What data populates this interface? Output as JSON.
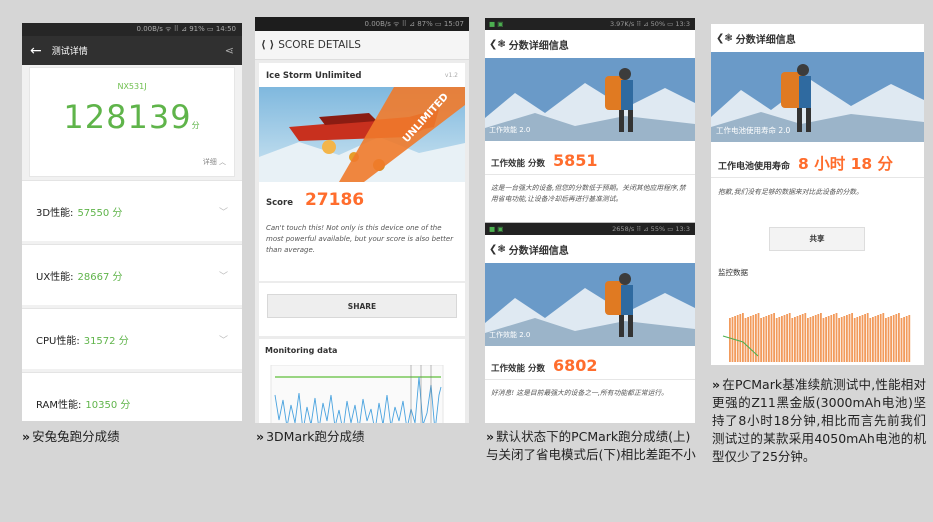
{
  "panel1": {
    "status": "0.00B/s ᯤ ⠿ ⊿ 91% ▭ 14:50",
    "title": "测试详情",
    "back": "←",
    "share": "⋖",
    "model": "NX531J",
    "score": "128139",
    "score_unit": "分",
    "detail": "详细 ︿",
    "rows": [
      {
        "label": "3D性能:",
        "value": "57550 分"
      },
      {
        "label": "UX性能:",
        "value": "28667 分"
      },
      {
        "label": "CPU性能:",
        "value": "31572 分"
      },
      {
        "label": "RAM性能:",
        "value": "10350 分"
      }
    ],
    "caption": "安兔兔跑分成绩"
  },
  "panel2": {
    "status": "0.00B/s ᯤ ⠿ ⊿ 87% ▭ 15:07",
    "header": "SCORE DETAILS",
    "test": "Ice Storm Unlimited",
    "test_info": "v1.2",
    "banner": "UNLIMITED",
    "score_label": "Score",
    "score": "27186",
    "desc": "Can't touch this! Not only is this device one of the most powerful available, but your score is also better than average.",
    "share": "SHARE",
    "monitoring": "Monitoring data",
    "caption": "3DMark跑分成绩"
  },
  "panel3": {
    "top": {
      "status": "3.97K/s ⠿ ⊿ 50% ▭ 13:3",
      "header": "分数详细信息",
      "overlay": "工作效能 2.0",
      "score_label": "工作效能 分数",
      "score": "5851",
      "desc": "这是一台强大的设备,但您的分数低于预期。关闭其他应用程序,禁用省电功能,让设备冷却后再进行基准测试。"
    },
    "bottom": {
      "status": "2658/s ⠿ ⊿ 55% ▭ 13:3",
      "header": "分数详细信息",
      "overlay": "工作效能 2.0",
      "score_label": "工作效能 分数",
      "score": "6802",
      "desc": "好消息! 这是目前最强大的设备之一,所有功能都正常运行。"
    },
    "caption": "默认状态下的PCMark跑分成绩(上)与关闭了省电模式后(下)相比差距不小"
  },
  "panel4": {
    "header": "分数详细信息",
    "overlay": "工作电池使用寿命 2.0",
    "score_label": "工作电池使用寿命",
    "score": "8 小时 18 分",
    "desc": "抱歉,我们没有足够的数据来对比此设备的分数。",
    "share": "共享",
    "monitoring": "监控数据",
    "caption": "在PCMark基准续航测试中,性能相对更强的Z11黑金版(3000mAh电池)坚持了8小时18分钟,相比而言先前我们测试过的某款采用4050mAh电池的机型仅少了25分钟。"
  },
  "caption_marker": "»",
  "colors": {
    "green": "#5fb44a",
    "orange": "#ff6d2d",
    "bg": "#d6d6d6"
  }
}
